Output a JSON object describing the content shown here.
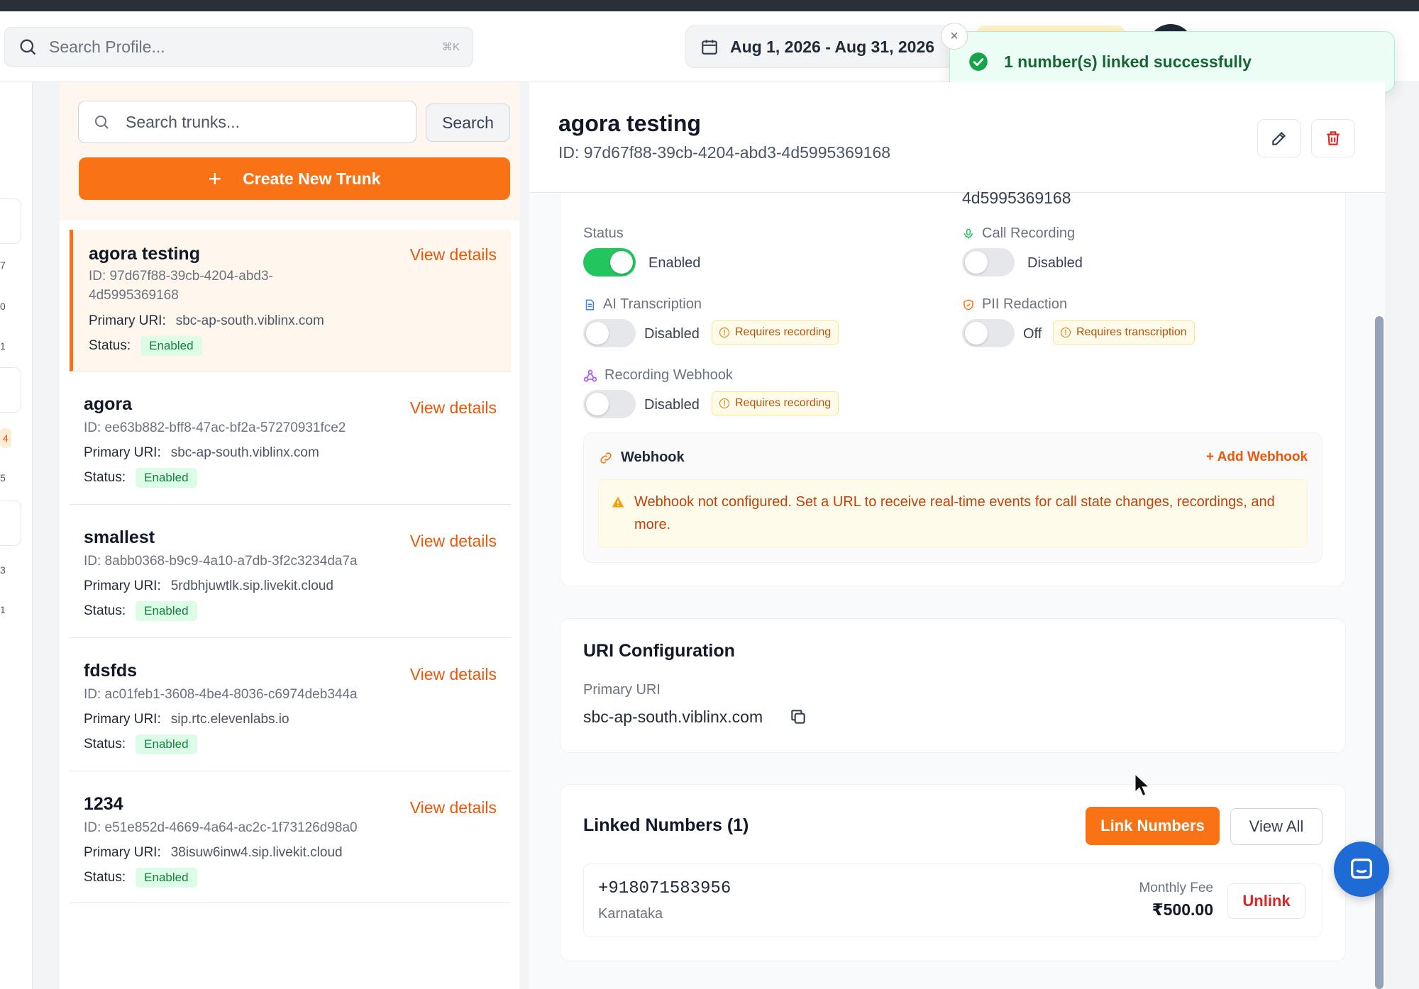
{
  "topbar": {
    "search_placeholder": "Search Profile...",
    "search_shortcut": "⌘K",
    "date_range": "Aug 1, 2026 - Aug 31, 2026"
  },
  "toast": {
    "message": "1 number(s) linked successfully",
    "close_label": "×"
  },
  "rail": {
    "numbers": [
      "7",
      "0",
      "1",
      "4",
      "5",
      "3",
      "1"
    ]
  },
  "trunk_list": {
    "search_placeholder": "Search trunks...",
    "search_button": "Search",
    "create_button": "Create New Trunk",
    "create_icon": "+",
    "view_details_label": "View details",
    "primary_uri_label": "Primary URI:",
    "status_label": "Status:",
    "items": [
      {
        "name": "agora testing",
        "id_line1": "ID: 97d67f88-39cb-4204-abd3-",
        "id_line2": "4d5995369168",
        "uri": "sbc-ap-south.viblinx.com",
        "status": "Enabled",
        "active": true
      },
      {
        "name": "agora",
        "id_line1": "ID: ee63b882-bff8-47ac-bf2a-57270931fce2",
        "uri": "sbc-ap-south.viblinx.com",
        "status": "Enabled"
      },
      {
        "name": "smallest",
        "id_line1": "ID: 8abb0368-b9c9-4a10-a7db-3f2c3234da7a",
        "uri": "5rdbhjuwtlk.sip.livekit.cloud",
        "status": "Enabled"
      },
      {
        "name": "fdsfds",
        "id_line1": "ID: ac01feb1-3608-4be4-8036-c6974deb344a",
        "uri": "sip.rtc.elevenlabs.io",
        "status": "Enabled"
      },
      {
        "name": "1234",
        "id_line1": "ID: e51e852d-4669-4a64-ac2c-1f73126d98a0",
        "uri": "38isuw6inw4.sip.livekit.cloud",
        "status": "Enabled"
      }
    ]
  },
  "detail": {
    "title": "agora testing",
    "id": "ID: 97d67f88-39cb-4204-abd3-4d5995369168",
    "cut_text": "4d5995369168",
    "settings": {
      "status": {
        "label": "Status",
        "value": "Enabled"
      },
      "call_recording": {
        "label": "Call Recording",
        "value": "Disabled"
      },
      "ai_transcription": {
        "label": "AI Transcription",
        "value": "Disabled",
        "note": "Requires recording"
      },
      "pii_redaction": {
        "label": "PII Redaction",
        "value": "Off",
        "note": "Requires transcription"
      },
      "recording_webhook": {
        "label": "Recording Webhook",
        "value": "Disabled",
        "note": "Requires recording"
      }
    },
    "webhook": {
      "title": "Webhook",
      "add_label": "+ Add Webhook",
      "warning": "Webhook not configured. Set a URL to receive real-time events for call state changes, recordings, and more."
    },
    "uri_config": {
      "title": "URI Configuration",
      "primary_label": "Primary URI",
      "primary_value": "sbc-ap-south.viblinx.com"
    },
    "linked_numbers": {
      "title": "Linked Numbers (1)",
      "link_button": "Link Numbers",
      "view_all_button": "View All",
      "items": [
        {
          "number": "+918071583956",
          "region": "Karnataka",
          "fee_label": "Monthly Fee",
          "fee": "₹500.00",
          "unlink_label": "Unlink"
        }
      ]
    }
  },
  "colors": {
    "accent": "#f97316",
    "success": "#22c55e",
    "danger": "#dc2626",
    "warning": "#b45309"
  }
}
